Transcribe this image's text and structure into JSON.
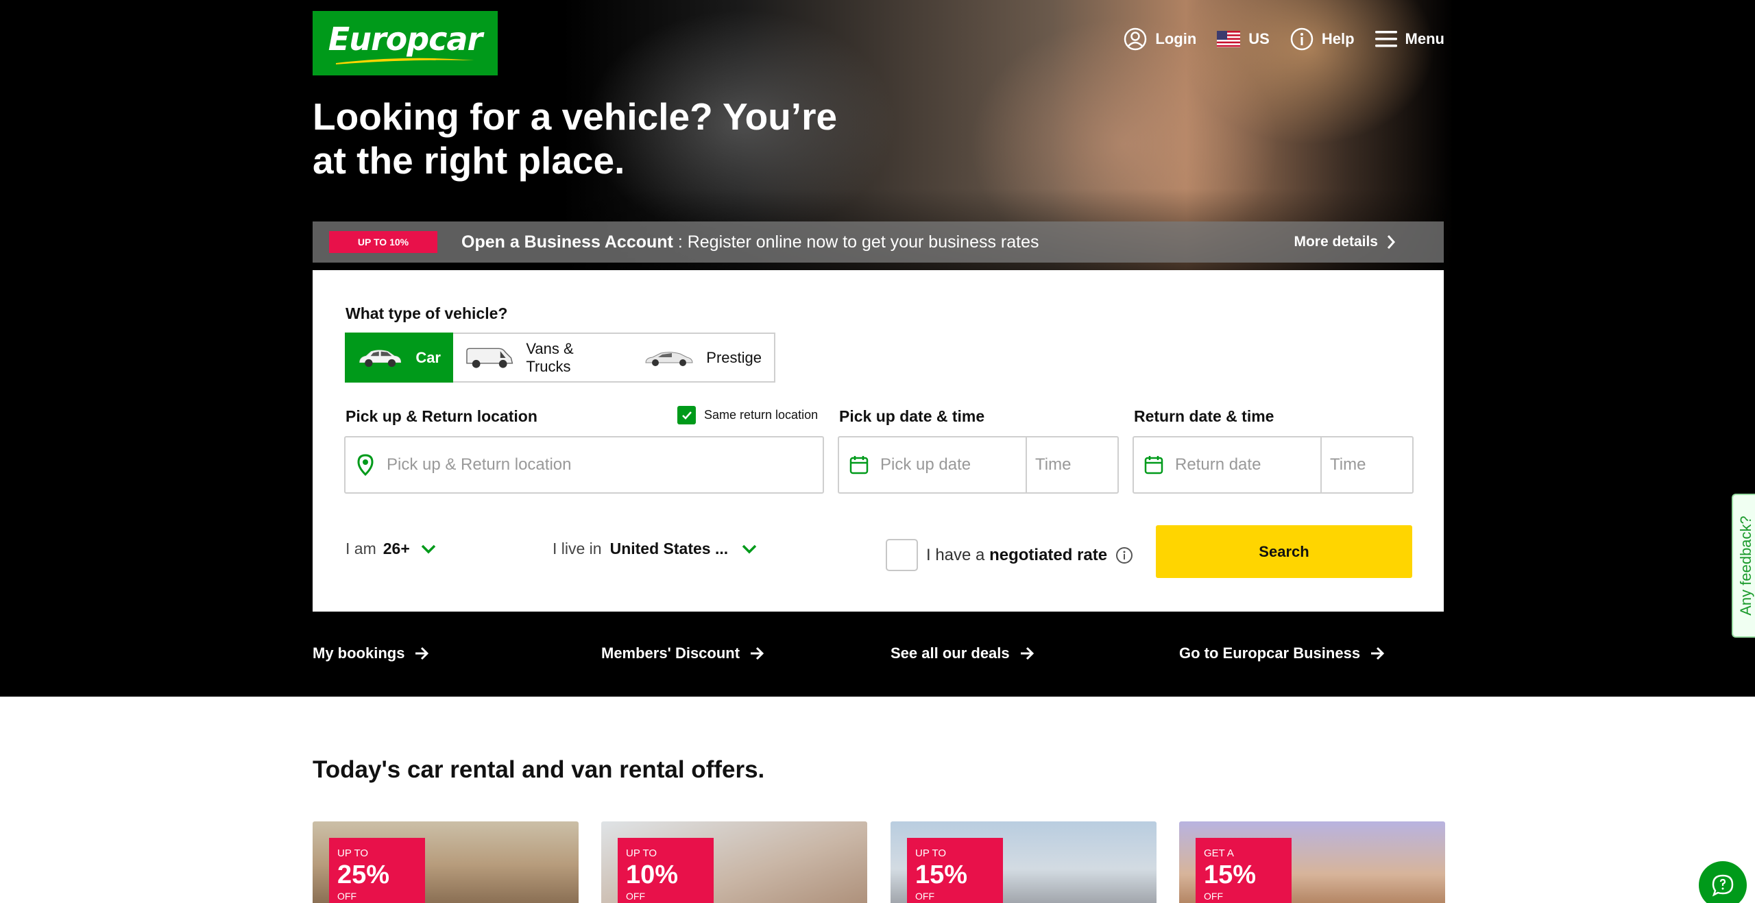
{
  "brand": {
    "logo_text": "Europcar",
    "green": "#009a1a",
    "pink": "#e8114a",
    "yellow": "#ffd500"
  },
  "topnav": {
    "login": "Login",
    "country": "US",
    "help": "Help",
    "menu": "Menu"
  },
  "hero": {
    "title": "Looking for a vehicle? You’re at the right place."
  },
  "promo": {
    "badge": "UP TO 10%",
    "title": "Open a Business Account",
    "text": " : Register online now to get your business rates",
    "more": "More details"
  },
  "search": {
    "vehicle_label": "What type of vehicle?",
    "vehicle_types": [
      {
        "label": "Car",
        "icon": "car-icon",
        "selected": true
      },
      {
        "label": "Vans & Trucks",
        "icon": "van-icon",
        "selected": false
      },
      {
        "label": "Prestige",
        "icon": "prestige-car-icon",
        "selected": false
      }
    ],
    "location_label": "Pick up & Return location",
    "same_return": "Same return location",
    "location_placeholder": "Pick up & Return location",
    "pickup_label": "Pick up date & time",
    "pickup_date_placeholder": "Pick up date",
    "pickup_time_placeholder": "Time",
    "return_label": "Return date & time",
    "return_date_placeholder": "Return date",
    "return_time_placeholder": "Time",
    "age_prefix": "I am",
    "age_value": "26+",
    "live_prefix": "I live in",
    "live_value": "United States ...",
    "nego_prefix": "I have a",
    "nego_bold": "negotiated rate",
    "search_button": "Search"
  },
  "quick_links": [
    "My bookings",
    "Members' Discount",
    "See all our deals",
    "Go to Europcar Business"
  ],
  "feedback": "Any feedback?",
  "offers": {
    "title": "Today's car rental and van rental offers.",
    "cards": [
      {
        "pre": "UP TO",
        "pct": "25%",
        "off": "OFF"
      },
      {
        "pre": "UP TO",
        "pct": "10%",
        "off": "OFF"
      },
      {
        "pre": "UP TO",
        "pct": "15%",
        "off": "OFF"
      },
      {
        "pre": "GET A",
        "pct": "15%",
        "off": "OFF"
      }
    ]
  }
}
